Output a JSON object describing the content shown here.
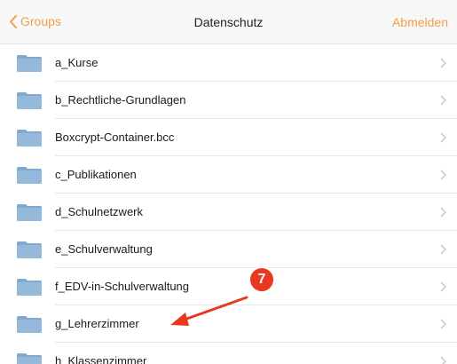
{
  "navbar": {
    "back_label": "Groups",
    "title": "Datenschutz",
    "action_label": "Abmelden"
  },
  "colors": {
    "accent": "#f0a04b",
    "folder": "#7fa9cf",
    "annotation": "#e8381f"
  },
  "items": [
    {
      "label": "a_Kurse"
    },
    {
      "label": "b_Rechtliche-Grundlagen"
    },
    {
      "label": "Boxcrypt-Container.bcc"
    },
    {
      "label": "c_Publikationen"
    },
    {
      "label": "d_Schulnetzwerk"
    },
    {
      "label": "e_Schulverwaltung"
    },
    {
      "label": "f_EDV-in-Schulverwaltung"
    },
    {
      "label": "g_Lehrerzimmer"
    },
    {
      "label": "h_Klassenzimmer"
    }
  ],
  "annotation": {
    "step_number": "7"
  }
}
